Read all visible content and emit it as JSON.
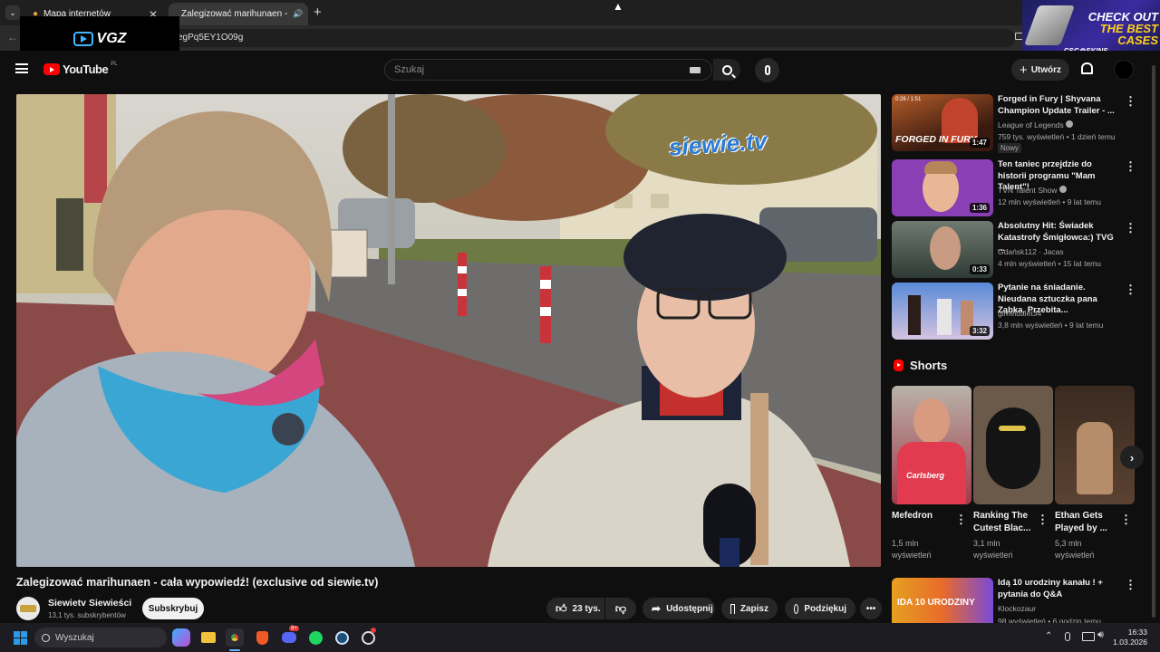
{
  "browser": {
    "tabs": [
      {
        "title": "Mapa internetów",
        "active": false
      },
      {
        "title": "Zalegizować marihunaen - ",
        "active": true
      }
    ],
    "url_fragment": "egPq5EY1O09g",
    "overlay_logo": "VGZ"
  },
  "ad": {
    "line1": "CHECK OUT",
    "line2": "THE BEST",
    "line3": "CASES",
    "brand": "CSG⚙SKINS"
  },
  "youtube": {
    "logo": "YouTube",
    "region": "PL",
    "search_placeholder": "Szukaj",
    "create_label": "Utwórz"
  },
  "video": {
    "overlay_brand": "siewie.tv",
    "title": "Zalegizować marihunaen - cała wypowiedź! (exclusive od siewie.tv)",
    "channel": "Siewietv Siewieści",
    "subscribers": "13,1 tys. subskrybentów",
    "subscribe_label": "Subskrybuj",
    "likes": "23 tys.",
    "share_label": "Udostępnij",
    "save_label": "Zapisz",
    "thanks_label": "Podziękuj"
  },
  "recommendations": [
    {
      "title": "Forged in Fury | Shyvana Champion Update Trailer - ...",
      "channel": "League of Legends",
      "verified": true,
      "meta": "759 tys. wyświetleń • 1 dzień temu",
      "badge": "Nowy",
      "duration": "1:47",
      "thumb_text": "FORGED IN FURY",
      "thumb_small": "0:26 / 1:51"
    },
    {
      "title": "Ten taniec przejdzie do historii programu \"Mam Talent\"!",
      "channel": "TVN Talent Show",
      "verified": true,
      "meta": "12 mln wyświetleń • 9 lat temu",
      "duration": "1:36"
    },
    {
      "title": "Absolutny Hit: Świadek Katastrofy Śmigłowca:) TVG ...",
      "channel": "Gdańsk112 · Jacas",
      "verified": false,
      "meta": "4 mln wyświetleń • 15 lat temu",
      "duration": "0:33"
    },
    {
      "title": "Pytanie na śniadanie. Nieudana sztuczka pana Ząbka. Przebita...",
      "channel": "gimeldalet34",
      "verified": false,
      "meta": "3,8 mln wyświetleń • 9 lat temu",
      "duration": "3:32"
    }
  ],
  "shorts": {
    "heading": "Shorts",
    "items": [
      {
        "title": "Mefedron",
        "views": "1,5 mln wyświetleń",
        "thumb_text": "Carlsberg"
      },
      {
        "title": "Ranking The Cutest Blac...",
        "views": "3,1 mln wyświetleń"
      },
      {
        "title": "Ethan Gets Played by ...",
        "views": "5,3 mln wyświetleń"
      }
    ]
  },
  "next_rec": {
    "title": "Idą 10 urodziny kanału ! + pytania do Q&A",
    "channel": "Klockozaur",
    "meta": "98 wyświetleń • 6 godzin temu",
    "thumb_text": "IDA 10 URODZINY"
  },
  "taskbar": {
    "search_placeholder": "Wyszukaj",
    "time": "16:33",
    "date": "1.03.2026",
    "discord_badge": "9+"
  }
}
